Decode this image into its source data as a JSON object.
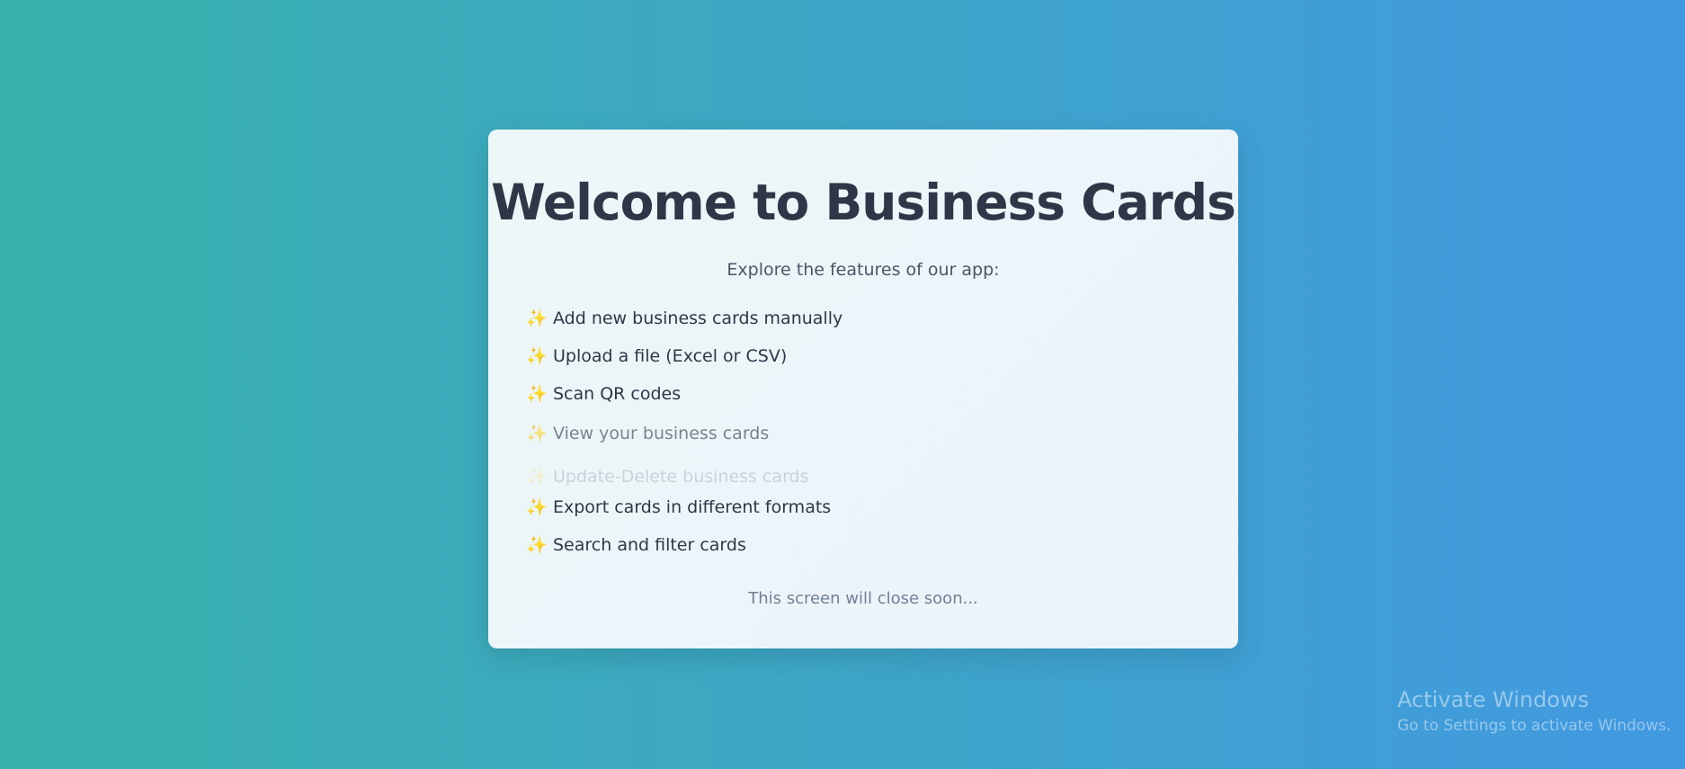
{
  "welcome": {
    "title": "Welcome to Business Cards",
    "subtitle": "Explore the features of our app:",
    "features": [
      {
        "icon": "sparkles-icon",
        "label": "Add new business cards manually"
      },
      {
        "icon": "sparkles-icon",
        "label": "Upload a file (Excel or CSV)"
      },
      {
        "icon": "sparkles-icon",
        "label": "Scan QR codes"
      },
      {
        "icon": "sparkles-icon",
        "label": "View your business cards"
      },
      {
        "icon": "sparkles-icon",
        "label": "Update-Delete business cards"
      },
      {
        "icon": "sparkles-icon",
        "label": "Export cards in different formats"
      },
      {
        "icon": "sparkles-icon",
        "label": "Search and filter cards"
      }
    ],
    "footer": "This screen will close soon..."
  },
  "watermark": {
    "title": "Activate Windows",
    "subtitle": "Go to Settings to activate Windows."
  },
  "colors": {
    "background_start": "#38b2ac",
    "background_end": "#4299e1",
    "title": "#2d3748",
    "sparkle": "#f6b93b"
  }
}
